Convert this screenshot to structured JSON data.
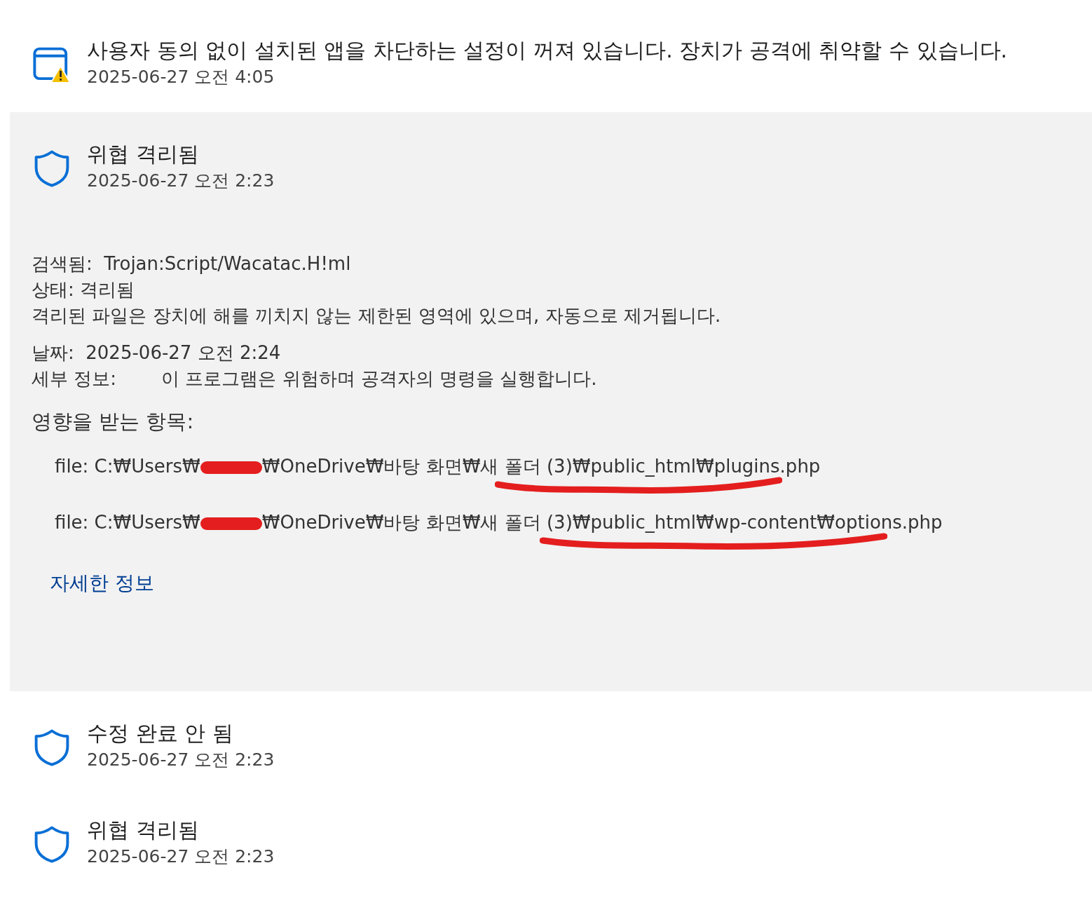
{
  "items": [
    {
      "kind": "app-warning",
      "title": "사용자 동의 없이 설치된 앱을 차단하는 설정이 꺼져 있습니다. 장치가 공격에 취약할 수 있습니다.",
      "time": "2025-06-27 오전 4:05",
      "expanded": false
    },
    {
      "kind": "shield",
      "title": "위협 격리됨",
      "time": "2025-06-27 오전 2:23",
      "expanded": true,
      "details": {
        "detected_label": "검색됨:",
        "detected": "Trojan:Script/Wacatac.H!ml",
        "status_label": "상태:",
        "status": "격리됨",
        "status_note": "격리된 파일은 장치에 해를 끼치지 않는 제한된 영역에 있으며, 자동으로 제거됩니다.",
        "date_label": "날짜:",
        "date": "2025-06-27 오전 2:24",
        "info_label": "세부 정보:",
        "info": "이 프로그램은 위험하며 공격자의 명령을 실행합니다.",
        "affected_heading": "영향을 받는 항목:",
        "files": [
          {
            "prefix": "file: C:₩Users₩",
            "middle": "₩OneDrive₩바탕 화면₩새 폴더 ",
            "marked": "(3)₩public_html₩plugins.php"
          },
          {
            "prefix": "file: C:₩Users₩",
            "middle": "₩OneDrive₩바탕 화면₩새 폴더 (3)",
            "marked": "₩public_html₩wp-content₩options.php"
          }
        ],
        "link": "자세한 정보"
      }
    },
    {
      "kind": "shield",
      "title": "수정 완료 안 됨",
      "time": "2025-06-27 오전 2:23",
      "expanded": false
    },
    {
      "kind": "shield",
      "title": "위협 격리됨",
      "time": "2025-06-27 오전 2:23",
      "expanded": false
    }
  ]
}
